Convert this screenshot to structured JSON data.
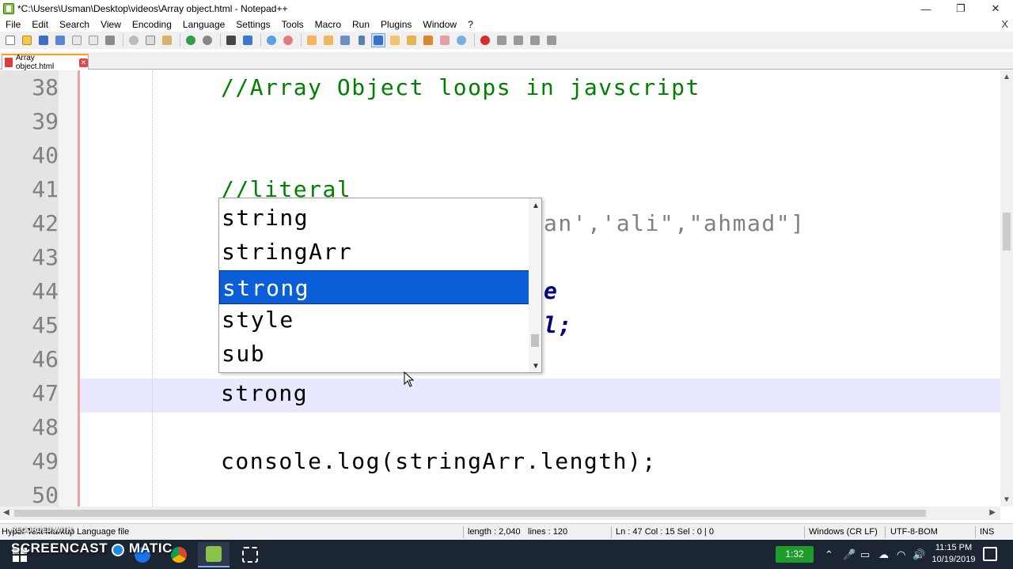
{
  "window": {
    "title": "*C:\\Users\\Usman\\Desktop\\videos\\Array object.html - Notepad++",
    "minimize": "—",
    "restore": "❐",
    "close": "✕"
  },
  "menu": {
    "items": [
      "File",
      "Edit",
      "Search",
      "View",
      "Encoding",
      "Language",
      "Settings",
      "Tools",
      "Macro",
      "Run",
      "Plugins",
      "Window",
      "?"
    ],
    "close_glyph": "X"
  },
  "toolbar": {
    "icons": [
      "new-file-icon",
      "open-file-icon",
      "save-icon",
      "save-all-icon",
      "close-file-icon",
      "close-all-icon",
      "print-icon",
      "cut-icon",
      "copy-icon",
      "paste-icon",
      "undo-icon",
      "redo-icon",
      "find-icon",
      "replace-icon",
      "zoom-in-icon",
      "zoom-out-icon",
      "sync-v-icon",
      "sync-h-icon",
      "word-wrap-icon",
      "show-all-chars-icon",
      "indent-guide-icon",
      "user-lang-icon",
      "doc-map-icon",
      "function-list-icon",
      "folder-workspace-icon",
      "monitor-icon",
      "record-macro-icon",
      "stop-macro-icon",
      "play-macro-icon",
      "run-macro-multiple-icon",
      "save-macro-icon"
    ]
  },
  "tabs": [
    {
      "label": "Array object.html",
      "close": "✕"
    }
  ],
  "editor": {
    "line_numbers": [
      "38",
      "39",
      "40",
      "41",
      "42",
      "43",
      "44",
      "45",
      "46",
      "47",
      "48",
      "49",
      "50"
    ],
    "lines": {
      "l38": "//Array Object loops in javscript",
      "l41": "//literal",
      "l42_tail": "an','ali\",\"ahmad\"]",
      "l44_tail": "e",
      "l45_tail": "l;",
      "l47": "strong",
      "l49": "console.log(stringArr.length);"
    },
    "current_line": "47"
  },
  "autocomplete": {
    "items": [
      "string",
      "stringArr",
      "strong",
      "style",
      "sub"
    ],
    "selected_index": 2
  },
  "status": {
    "file_type": "Hyper Text Markup Language file",
    "length": "length : 2,040",
    "lines": "lines : 120",
    "position": "Ln : 47    Col : 15    Sel : 0 | 0",
    "eol": "Windows (CR LF)",
    "encoding": "UTF-8-BOM",
    "mode": "INS"
  },
  "watermark": {
    "top": "RECORDED WITH",
    "main": "SCREENCAST",
    "suffix": "MATIC"
  },
  "taskbar": {
    "timer": "1:32",
    "time": "11:15 PM",
    "date": "10/19/2019"
  },
  "colors": {
    "comment": "#008000",
    "selection": "#0a5ed7",
    "current_line": "#e8e8ff",
    "taskbar": "#1c2533"
  }
}
